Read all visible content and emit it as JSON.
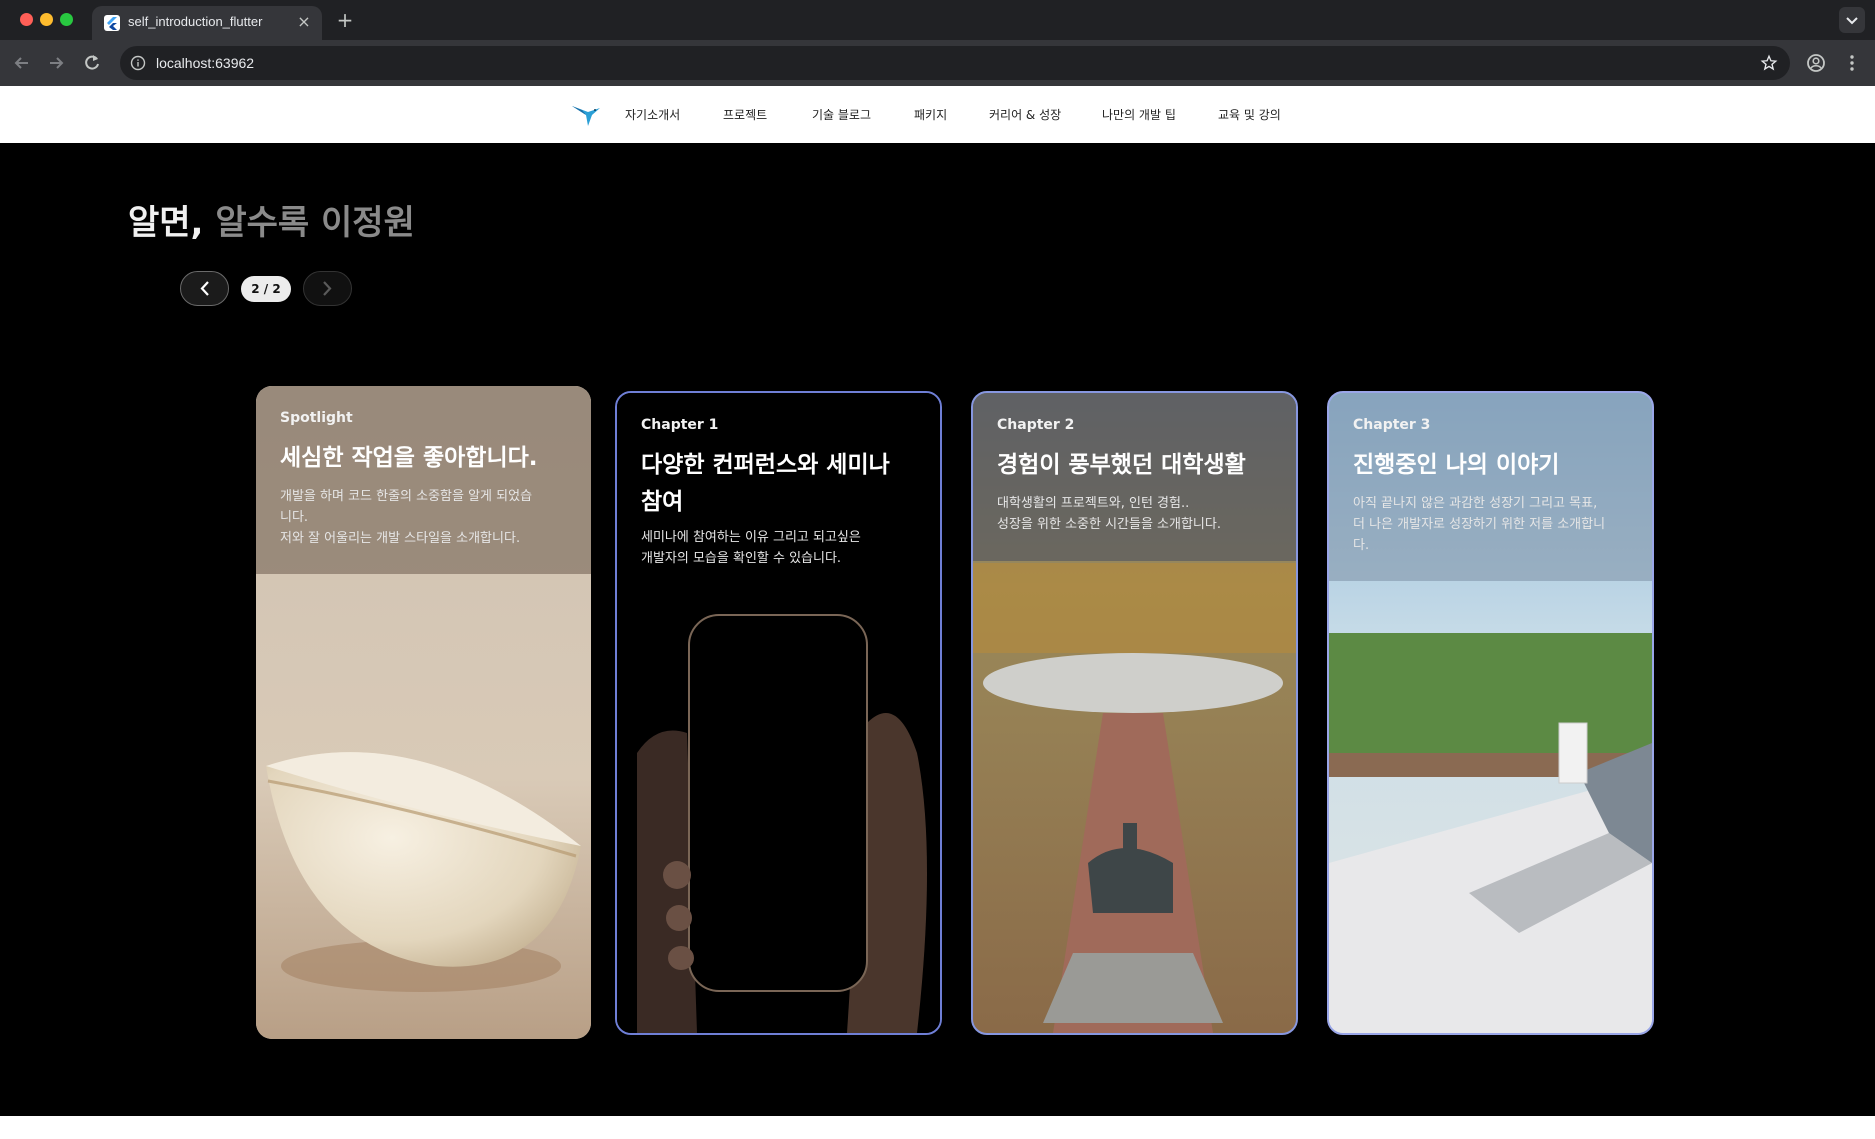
{
  "browser": {
    "tab_title": "self_introduction_flutter",
    "url": "localhost:63962"
  },
  "nav": {
    "items": [
      "자기소개서",
      "프로젝트",
      "기술 블로그",
      "패키지",
      "커리어 & 성장",
      "나만의 개발 팁",
      "교육 및 강의"
    ]
  },
  "hero": {
    "headline_bright": "알면,",
    "headline_dim": "알수록 이정원"
  },
  "pager": {
    "count": "2 / 2"
  },
  "cards": [
    {
      "label": "Spotlight",
      "title": "세심한 작업을 좋아합니다.",
      "desc": [
        " 개발을 하며 코드 한줄의 소중함을 알게 되었습",
        "니다.",
        "저와 잘 어울리는 개발 스타일을 소개합니다."
      ]
    },
    {
      "label": "Chapter 1",
      "title_lines": [
        "다양한 컨퍼런스와 세미나",
        "참여"
      ],
      "desc": [
        " 세미나에 참여하는 이유 그리고 되고싶은",
        "개발자의 모습을 확인할 수 있습니다."
      ]
    },
    {
      "label": "Chapter 2",
      "title": "경험이 풍부했던 대학생활",
      "desc": [
        " 대학생활의 프로젝트와, 인턴 경험..",
        "성장을 위한 소중한 시간들을 소개합니다."
      ]
    },
    {
      "label": "Chapter 3",
      "title": "진행중인 나의 이야기",
      "desc": [
        " 아직 끝나지 않은 과감한 성장기 그리고 목표,",
        "더 나은 개발자로 성장하기 위한 저를 소개합니",
        "다."
      ]
    }
  ],
  "colors": {
    "card_border_chapter": "#6f7fd6",
    "page_background": "#000000",
    "nav_background": "#ffffff"
  }
}
